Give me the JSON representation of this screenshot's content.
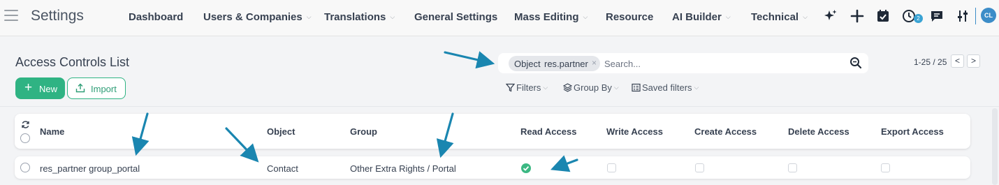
{
  "navbar": {
    "app_title": "Settings",
    "menu": [
      {
        "label": "Dashboard",
        "dropdown": false
      },
      {
        "label": "Users & Companies",
        "dropdown": true
      },
      {
        "label": "Translations",
        "dropdown": true
      },
      {
        "label": "General Settings",
        "dropdown": false
      },
      {
        "label": "Mass Editing",
        "dropdown": true
      },
      {
        "label": "Resource",
        "dropdown": false
      },
      {
        "label": "AI Builder",
        "dropdown": true
      },
      {
        "label": "Technical",
        "dropdown": true
      }
    ],
    "systray": {
      "icons": [
        "sparkle-icon",
        "plus-icon",
        "calendar-check-icon",
        "clock-icon",
        "chat-icon",
        "sliders-icon"
      ],
      "activity_badge": "2",
      "avatar_initials": "CL",
      "accent_color": "#3c8dc8"
    }
  },
  "control_panel": {
    "title": "Access Controls List",
    "new_label": "New",
    "import_label": "Import",
    "search": {
      "facet_label": "Object",
      "facet_value": "res.partner",
      "placeholder": "Search..."
    },
    "filters_label": "Filters",
    "group_by_label": "Group By",
    "saved_filters_label": "Saved filters",
    "pager": {
      "value": "1-25 / 25",
      "prev": "<",
      "next": ">"
    }
  },
  "list": {
    "columns": [
      "Name",
      "Object",
      "Group",
      "Read Access",
      "Write Access",
      "Create Access",
      "Delete Access",
      "Export Access"
    ],
    "rows": [
      {
        "name": "res_partner group_portal",
        "object": "Contact",
        "group": "Other Extra Rights / Portal",
        "read": true,
        "write": false,
        "create": false,
        "delete": false,
        "export": false
      }
    ]
  },
  "colors": {
    "primary": "#2fb383",
    "check_green": "#3cb883",
    "annotation_arrow": "#1a86b0"
  }
}
